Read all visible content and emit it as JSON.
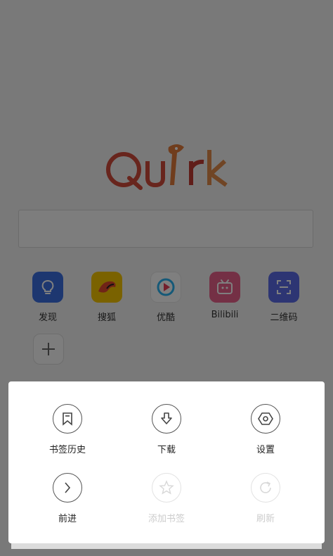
{
  "logo": {
    "text": "Quirk"
  },
  "search": {
    "placeholder": ""
  },
  "shortcuts": [
    {
      "label": "发现",
      "icon": "lightbulb-icon",
      "color": "#3a6fe0"
    },
    {
      "label": "搜狐",
      "icon": "sohu-fox-icon",
      "color": "#f5c400"
    },
    {
      "label": "优酷",
      "icon": "youku-play-icon",
      "color": "#ffffff"
    },
    {
      "label": "Bilibili",
      "icon": "bilibili-tv-icon",
      "color": "#e8608a"
    },
    {
      "label": "二维码",
      "icon": "qr-scan-icon",
      "color": "#5b6be6"
    }
  ],
  "add_shortcut": {
    "icon": "plus-icon"
  },
  "menu": {
    "row1": [
      {
        "label": "书签历史",
        "icon": "bookmark-icon",
        "enabled": true
      },
      {
        "label": "下载",
        "icon": "download-icon",
        "enabled": true
      },
      {
        "label": "设置",
        "icon": "settings-hexagon-icon",
        "enabled": true
      }
    ],
    "row2": [
      {
        "label": "前进",
        "icon": "forward-chevron-icon",
        "enabled": true
      },
      {
        "label": "添加书签",
        "icon": "star-icon",
        "enabled": false
      },
      {
        "label": "刷新",
        "icon": "refresh-icon",
        "enabled": false
      }
    ]
  }
}
